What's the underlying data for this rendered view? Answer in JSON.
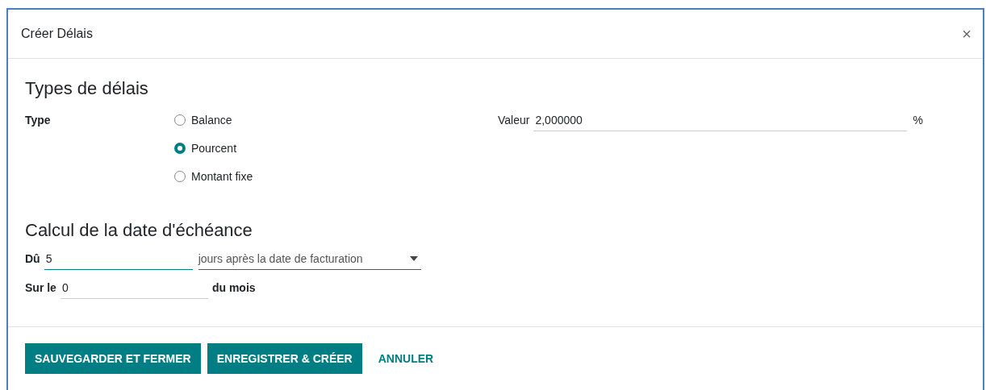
{
  "dialog": {
    "title": "Créer Délais",
    "close": "×"
  },
  "types_section": {
    "heading": "Types de délais",
    "type_label": "Type",
    "options": [
      {
        "label": "Balance",
        "selected": false
      },
      {
        "label": "Pourcent",
        "selected": true
      },
      {
        "label": "Montant fixe",
        "selected": false
      }
    ],
    "value_label": "Valeur",
    "value": "2,000000",
    "unit": "%"
  },
  "due_section": {
    "heading": "Calcul de la date d'échéance",
    "due_label": "Dû",
    "due_value": "5",
    "due_focused": true,
    "due_option": "jours après la date de facturation",
    "day_label": "Sur le",
    "day_value": "0",
    "day_suffix": "du mois"
  },
  "buttons": [
    {
      "label": "SAUVEGARDER ET FERMER",
      "kind": "primary"
    },
    {
      "label": "ENREGISTRER & CRÉER",
      "kind": "primary"
    },
    {
      "label": "ANNULER",
      "kind": "link"
    }
  ]
}
